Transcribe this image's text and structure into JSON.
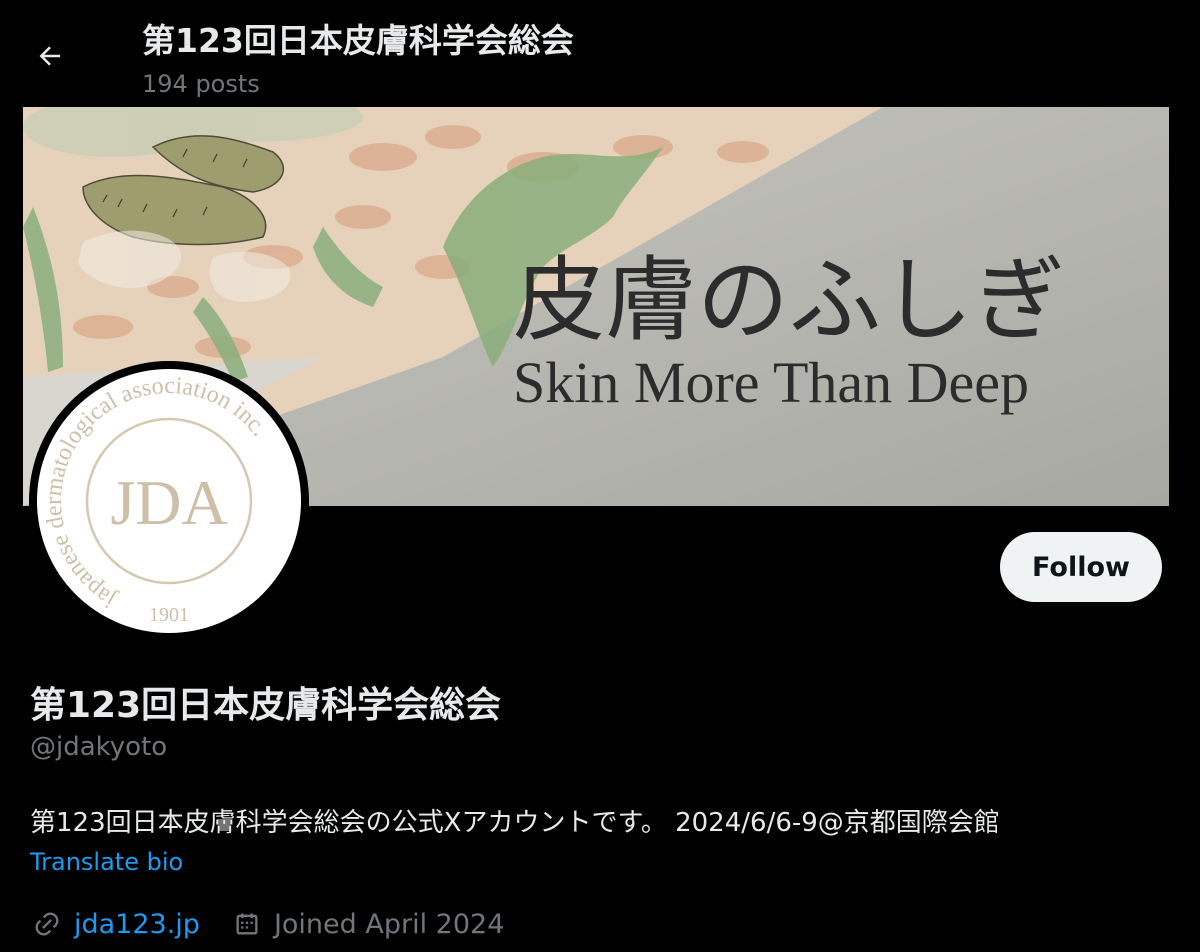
{
  "header": {
    "title": "第123回日本皮膚科学会総会",
    "posts_count": "194 posts",
    "back_icon": "arrow-left-icon"
  },
  "banner": {
    "jp_title": "皮膚のふしぎ",
    "en_title": "Skin More Than Deep"
  },
  "avatar": {
    "logo_text": "JDA",
    "ring_text": "japanese dermatological association inc.",
    "year": "1901"
  },
  "follow_label": "Follow",
  "profile": {
    "display_name": "第123回日本皮膚科学会総会",
    "handle": "@jdakyoto",
    "bio": "第123回日本皮膚科学会総会の公式Xアカウントです。 2024/6/6-9@京都国際会館",
    "translate_label": "Translate bio",
    "website": "jda123.jp",
    "website_icon": "link-icon",
    "joined": "Joined April 2024",
    "joined_icon": "calendar-icon"
  },
  "colors": {
    "background": "#000000",
    "text": "#e7e9ea",
    "muted": "#71767b",
    "link": "#1d9bf0",
    "follow_bg": "#eff3f4"
  }
}
